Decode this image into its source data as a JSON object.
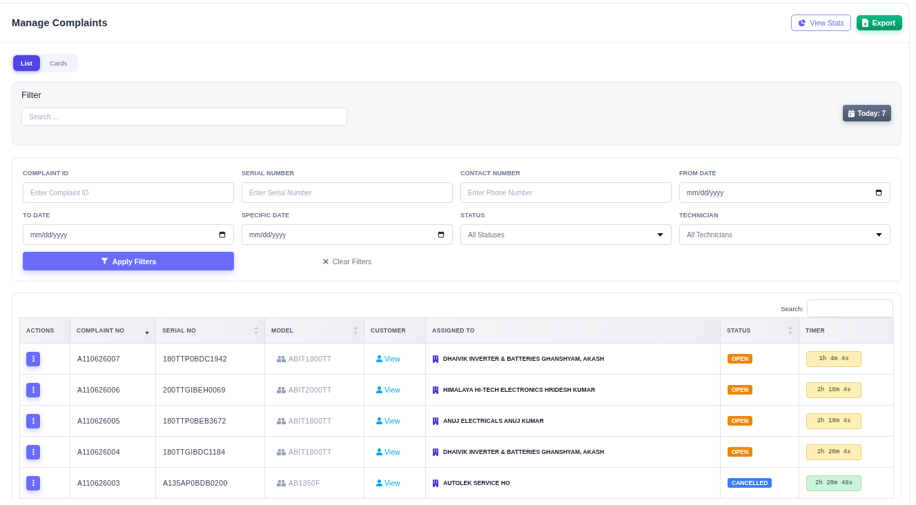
{
  "header": {
    "title": "Manage Complaints",
    "buttons": [
      {
        "kind": "stats",
        "label": "View Stats"
      },
      {
        "kind": "export",
        "label": "Export"
      }
    ]
  },
  "view_tabs": [
    {
      "label": "List",
      "selected": true
    },
    {
      "label": "Cards",
      "selected": false
    }
  ],
  "filter": {
    "title": "Filter",
    "search": {
      "placeholder": "Search ..."
    },
    "today_badge": "Today: 7"
  },
  "filter_form": {
    "fields": [
      {
        "kind": "text",
        "label": "COMPLAINT ID",
        "placeholder": "Enter Complaint ID"
      },
      {
        "kind": "text",
        "label": "SERIAL NUMBER",
        "placeholder": "Enter Serial Number"
      },
      {
        "kind": "text",
        "label": "CONTACT NUMBER",
        "placeholder": "Enter Phone Number"
      },
      {
        "kind": "date",
        "label": "FROM DATE",
        "placeholder": "mm/dd/yyyy"
      },
      {
        "kind": "date",
        "label": "TO DATE",
        "placeholder": "mm/dd/yyyy"
      },
      {
        "kind": "date",
        "label": "SPECIFIC DATE",
        "placeholder": "mm/dd/yyyy"
      },
      {
        "kind": "select",
        "label": "STATUS",
        "value": "All Statuses"
      },
      {
        "kind": "select",
        "label": "TECHNICIAN",
        "value": "All Technicians"
      }
    ],
    "apply_button": "Apply Filters",
    "clear_button": "Clear Filters"
  },
  "table": {
    "search_label": "Search:",
    "columns": [
      {
        "label": "ACTIONS",
        "sortable": false,
        "sorted": false
      },
      {
        "label": "COMPLAINT NO",
        "sortable": true,
        "sorted": true
      },
      {
        "label": "SERIAL NO",
        "sortable": true,
        "sorted": false
      },
      {
        "label": "MODEL",
        "sortable": true,
        "sorted": false
      },
      {
        "label": "CUSTOMER",
        "sortable": false,
        "sorted": false
      },
      {
        "label": "ASSIGNED TO",
        "sortable": false,
        "sorted": false
      },
      {
        "label": "STATUS",
        "sortable": true,
        "sorted": false
      },
      {
        "label": "TIMER",
        "sortable": false,
        "sorted": false
      }
    ],
    "rows": [
      {
        "complaint_no": "A110626007",
        "serial_no": "180TTP0BDC1942",
        "model": "ABIT1800TT",
        "customer": "View",
        "assigned_to": "DHAIVIK INVERTER & BATTERIES GHANSHYAM, AKASH",
        "status": {
          "label": "OPEN",
          "color": "#e8890c"
        },
        "timer": {
          "label": "1h 4m 4s",
          "color": "#fdefb6"
        }
      },
      {
        "complaint_no": "A110626006",
        "serial_no": "200TTGIBEH0069",
        "model": "ABIT2000TT",
        "customer": "View",
        "assigned_to": "HIMALAYA HI-TECH ELECTRONICS HRIDESH KUMAR",
        "status": {
          "label": "OPEN",
          "color": "#e8890c"
        },
        "timer": {
          "label": "2h 18m 4s",
          "color": "#fdefb6"
        }
      },
      {
        "complaint_no": "A110626005",
        "serial_no": "180TTP0BEB3672",
        "model": "ABIT1800TT",
        "customer": "View",
        "assigned_to": "ANUJ ELECTRICALS ANUJ KUMAR",
        "status": {
          "label": "OPEN",
          "color": "#e8890c"
        },
        "timer": {
          "label": "2h 19m 4s",
          "color": "#fdefb6"
        }
      },
      {
        "complaint_no": "A110626004",
        "serial_no": "180TTGIBDC1184",
        "model": "ABIT1800TT",
        "customer": "View",
        "assigned_to": "DHAIVIK INVERTER & BATTERIES GHANSHYAM, AKASH",
        "status": {
          "label": "OPEN",
          "color": "#e8890c"
        },
        "timer": {
          "label": "2h 20m 4s",
          "color": "#fdefb6"
        }
      },
      {
        "complaint_no": "A110626003",
        "serial_no": "A135AP0BDB0200",
        "model": "AB1350F",
        "customer": "View",
        "assigned_to": "AUTOLEK SERVICE HO",
        "status": {
          "label": "CANCELLED",
          "color": "#3b7df0"
        },
        "timer": {
          "label": "2h 20m 48s",
          "color": "#c8f4de"
        }
      }
    ]
  }
}
